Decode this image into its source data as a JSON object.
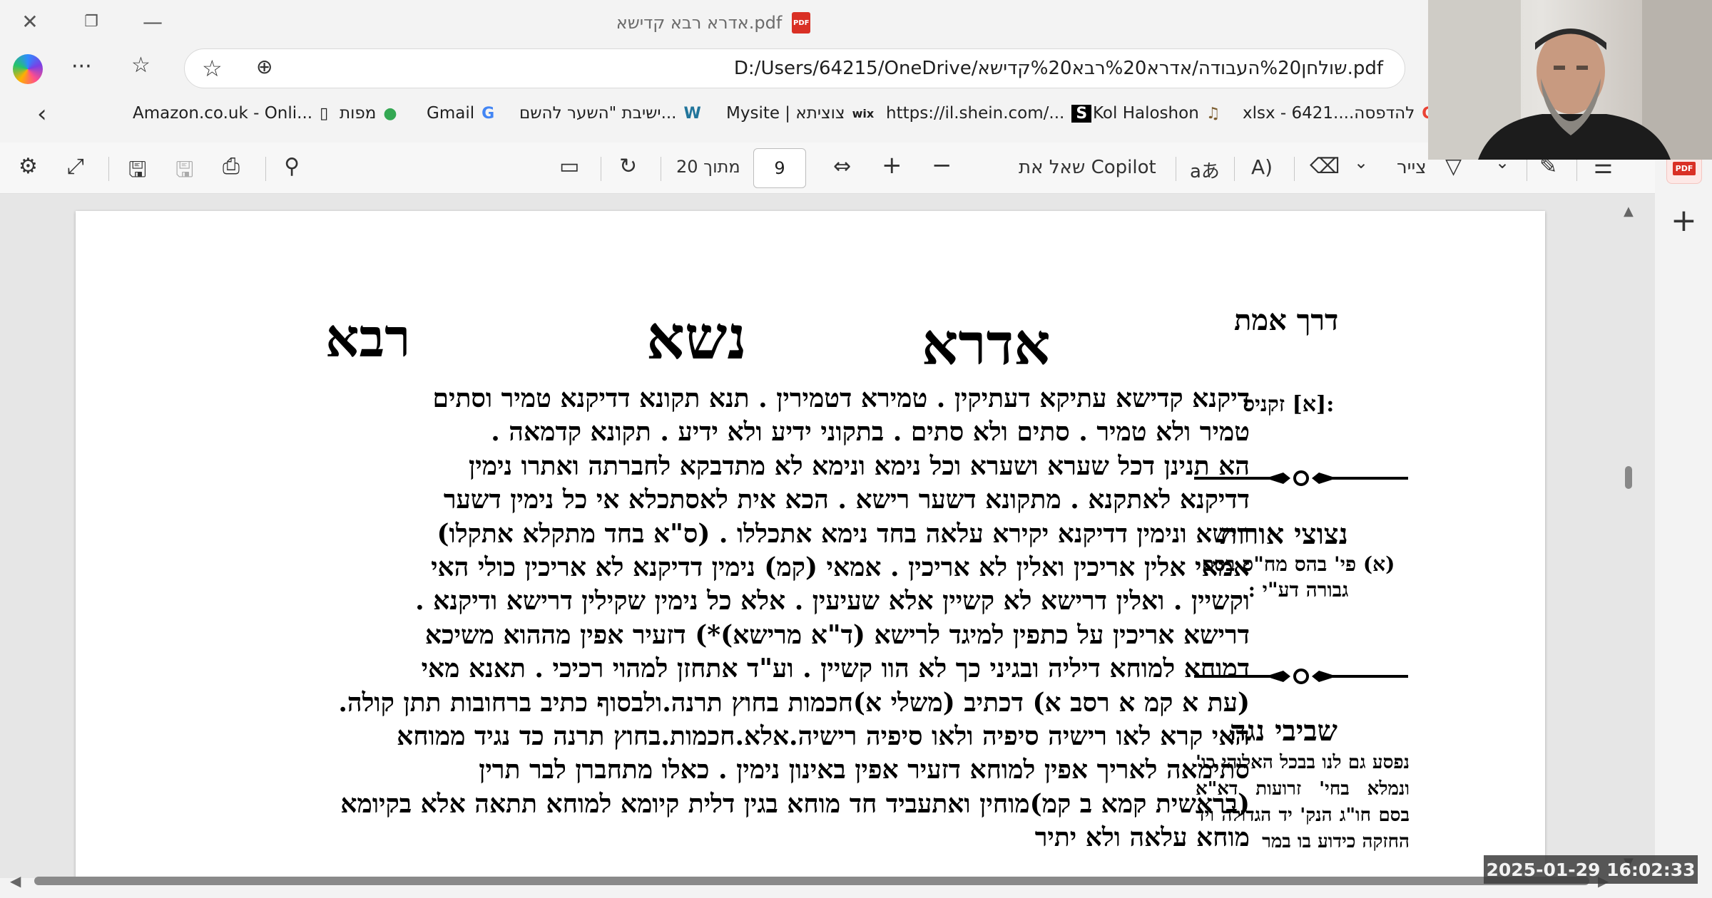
{
  "window": {
    "tab_title": "אדרא רבא קדישא.pdf",
    "close_glyph": "✕",
    "restore_glyph": "❐",
    "minimize_glyph": "—"
  },
  "address": {
    "url": "D:/Users/64215/OneDrive/שולחן%20העבודה/אדרא%20רבא%20קדישא.pdf",
    "star_glyph": "☆",
    "zoom_glyph": "⊕",
    "more_glyph": "···",
    "favorites_glyph": "☆"
  },
  "favorites": [
    {
      "label": "Amazon.co.uk - Onli...",
      "icon": "page-icon",
      "glyph": "▯"
    },
    {
      "label": "מפות",
      "icon": "maps-pin-icon",
      "glyph": "●",
      "color": "#34a853"
    },
    {
      "label": "Gmail",
      "icon": "google-icon",
      "glyph": "G",
      "color": "#4285f4"
    },
    {
      "label": "ישיבת \"השער להשם...",
      "icon": "wordpress-icon",
      "glyph": "W",
      "color": "#21759b"
    },
    {
      "label": "Mysite | צוציתא",
      "icon": "wix-icon",
      "glyph": "wix",
      "color": "#000000"
    },
    {
      "label": "https://il.shein.com/...",
      "icon": "shein-icon",
      "glyph": "S",
      "color": "#000000"
    },
    {
      "label": "Kol Haloshon",
      "icon": "kol-haloshon-icon",
      "glyph": "♫",
      "color": "#7a5c2e"
    },
    {
      "label": "xlsx - 6421....להדפסה",
      "icon": "google-icon",
      "glyph": "G",
      "color": "#ea4335"
    }
  ],
  "favorites_back_glyph": "‹",
  "toolbar": {
    "page_number": "9",
    "page_total": "מתוך 20",
    "ask_copilot": "שאל את Copilot",
    "draw": "צייר",
    "plus_glyph": "+",
    "minus_glyph": "−",
    "settings_glyph": "⚙",
    "expand_glyph": "⤢",
    "save_as_glyph": "🖫",
    "save_glyph": "🖫",
    "print_glyph": "⎙",
    "search_glyph": "⚲",
    "page_view_glyph": "▭",
    "rotate_glyph": "↻",
    "fit_glyph": "⇔",
    "translate_glyph": "aあ",
    "read_aloud_glyph": "A)",
    "erase_glyph": "⌫",
    "chevron_glyph": "⌄",
    "highlight_glyph": "▽",
    "draw_pen_glyph": "✎",
    "contents_glyph": "☰"
  },
  "side_plus_glyph": "+",
  "pdf_badge": "PDF",
  "document": {
    "header_rabba": "רבא",
    "header_nasa": "נשא",
    "header_idra": "אדרא",
    "header_derech": "דרך אמת",
    "derech_note": ":[א] זקניס",
    "notzotzei_title": "נצוצי אורות",
    "notzotzei_note": "(א) פי' בהס מח\"ס בסם גבורה דע\"י :",
    "shvivei_title": "שביבי נגה",
    "shvivei_note": "נפסע גם לנו בבכל האלוהי כו' ונמלא בחי' זרועות דא\"א בסם חו\"ג הנק' יד הגדולה ויד החזקה כידוע בו במר",
    "lines": [
      "דיקנא קדישא עתיקא דעתיקין . טמירא דטמירין . תנא תקונא דדיקנא טמיר וסתים",
      "טמיר ולא טמיר . סתים ולא סתים . בתקוני ידיע ולא ידיע . תקונא קדמאה .",
      "הא תנינן דכל שערא ושערא וכל נימא ונימא לא מתדבקא לחברתה ואתרו נימין",
      "דדיקנא לאתקנא . מתקונא דשער רישא . הכא אית לאסתכלא אי כל נימין דשער",
      "רישא ונימין דדיקנא יקירא עלאה בחד נימא אתכללו . (ס\"א בחד מתקלא אתקלו)",
      "אמאי אלין אריכין ואלין לא אריכין . אמאי (קמ) נימין דדיקנא לא אריכין כולי האי",
      "וקשיין . ואלין דרישא לא קשיין אלא שעיעין . אלא כל נימין שקילין דרישא ודיקנא .",
      "דרישא אריכין על כתפין למיגד לרישא (ד\"א מרישא)*) דזעיר אפין מההוא משיכא",
      "דמוחא למוחא דיליה ובגיני כך לא הוו קשיין . וע\"ד אתחזן למהוי רכיכי . תאנא מאי",
      "(עת א קמ א רסב א) דכתיב (משלי א)חכמות בחוץ תרנה.ולבסוף כתיב ברחובות תתן קולה.",
      "האי קרא לאו רישיה סיפיה ולאו סיפיה רישיה.אלא.חכמות.בחוץ תרנה כד נגיד ממוחא",
      "סתימאה לאריך אפין למוחא דזעיר אפין באינון נימין . כאלו מתחברן לבר תרין",
      "(בראשית קמא ב קמ)מוחין ואתעביד חד מוחא בגין דלית קיומא למוחא תתאה אלא בקיומא",
      "מוחא עלאה ולא יתיר"
    ]
  },
  "timestamp": "2025-01-29 16:02:33"
}
